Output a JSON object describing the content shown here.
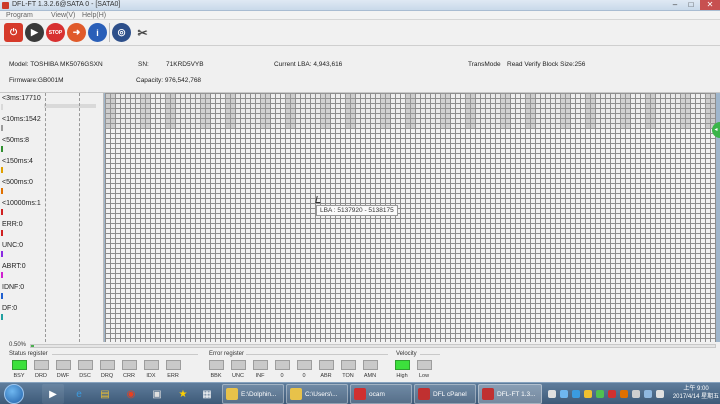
{
  "window": {
    "title": "DFL-FT 1.3.2.6@SATA 0 - [SATA0]"
  },
  "menu": [
    "Program",
    "View(V)",
    "Help(H)"
  ],
  "toolbar_icons": [
    "power-icon",
    "play-icon",
    "stop-icon",
    "forward-icon",
    "info-icon",
    "scan-icon",
    "tools-icon"
  ],
  "info": {
    "model": "Model: TOSHIBA MK5076GSXN",
    "sn_label": "SN:",
    "sn_value": "71KRD5VYB",
    "current_lba": "Current LBA: 4,943,616",
    "transmode": "TransMode",
    "read_verify": "Read Verify Block Size:256",
    "firmware": "Firmware:GB001M",
    "capacity": "Capacity: 976,542,768"
  },
  "legend": [
    {
      "label": "<3ms:17710",
      "color": "#d9d9d9"
    },
    {
      "label": "<10ms:1542",
      "color": "#9a9a9a"
    },
    {
      "label": "<50ms:8",
      "color": "#2f8f2f"
    },
    {
      "label": "<150ms:4",
      "color": "#e0a000"
    },
    {
      "label": "<500ms:0",
      "color": "#e07000"
    },
    {
      "label": "<10000ms:1",
      "color": "#d02020"
    },
    {
      "label": "ERR:0",
      "color": "#d02020"
    },
    {
      "label": "UNC:0",
      "color": "#8a2be2"
    },
    {
      "label": "ABRT:0",
      "color": "#d020d0"
    },
    {
      "label": "IDNF:0",
      "color": "#2060d0"
    },
    {
      "label": "DF:0",
      "color": "#20a0a0"
    }
  ],
  "tooltip": "LBA : 5137920 - 5138175",
  "progress": {
    "text": "0.50%",
    "value": 0.5
  },
  "status_register": {
    "title": "Status register",
    "leds": [
      {
        "label": "BSY",
        "on": true
      },
      {
        "label": "DRD",
        "on": false
      },
      {
        "label": "DWF",
        "on": false
      },
      {
        "label": "DSC",
        "on": false
      },
      {
        "label": "DRQ",
        "on": false
      },
      {
        "label": "CRR",
        "on": false
      },
      {
        "label": "IDX",
        "on": false
      },
      {
        "label": "ERR",
        "on": false
      }
    ]
  },
  "error_register": {
    "title": "Error register",
    "leds": [
      {
        "label": "BBK",
        "on": false
      },
      {
        "label": "UNC",
        "on": false
      },
      {
        "label": "INF",
        "on": false
      },
      {
        "label": "0",
        "on": false
      },
      {
        "label": "0",
        "on": false
      },
      {
        "label": "ABR",
        "on": false
      },
      {
        "label": "TON",
        "on": false
      },
      {
        "label": "AMN",
        "on": false
      }
    ]
  },
  "velocity": {
    "title": "Velocity",
    "leds": [
      {
        "label": "High",
        "on": true
      },
      {
        "label": "Low",
        "on": false
      }
    ]
  },
  "taskbar": {
    "tasks": [
      {
        "label": "E:\\Dolphin...",
        "color": "#e8c24a"
      },
      {
        "label": "C:\\Users\\...",
        "color": "#e8c24a"
      },
      {
        "label": "ocam",
        "color": "#d03030"
      },
      {
        "label": "DFL cPanel",
        "color": "#c03030"
      },
      {
        "label": "DFL-FT 1.3...",
        "color": "#c03030"
      }
    ],
    "clock_time": "上午 9:00",
    "clock_date": "2017/4/14 星期五"
  }
}
